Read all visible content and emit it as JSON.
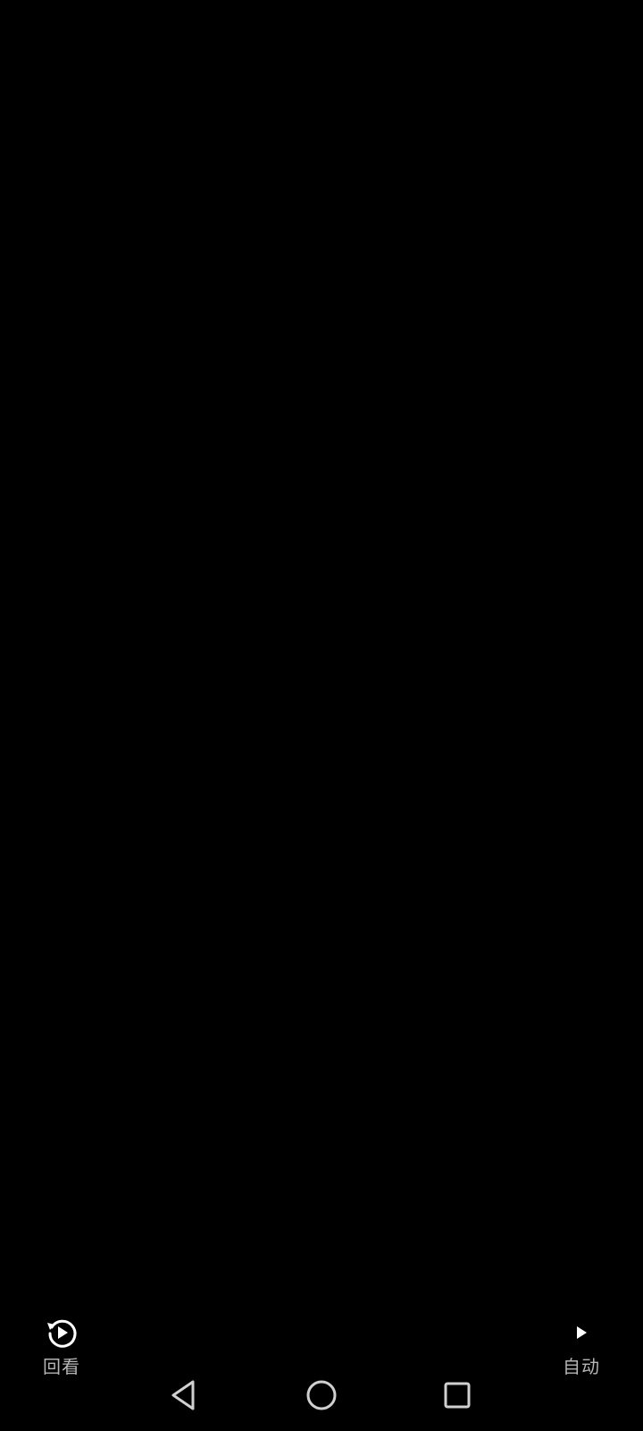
{
  "player": {
    "replay": {
      "label": "回看",
      "icon": "replay-play-icon"
    },
    "auto": {
      "label": "自动",
      "icon": "play-icon"
    }
  },
  "navbar": {
    "back_icon": "triangle-back-icon",
    "home_icon": "circle-home-icon",
    "recent_icon": "square-recents-icon"
  },
  "colors": {
    "background": "#000000",
    "icon": "#ffffff",
    "label": "#b5b5b5",
    "nav": "#d0d0d0"
  }
}
